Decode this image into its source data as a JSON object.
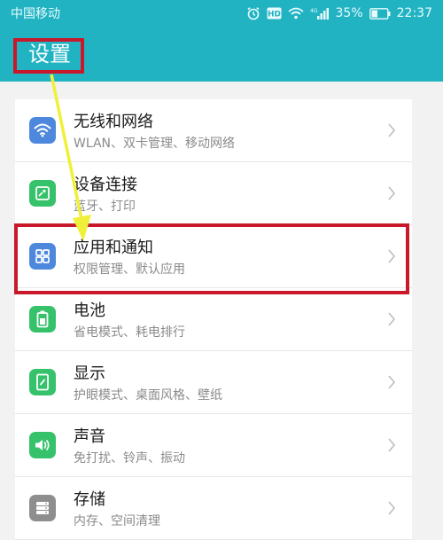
{
  "status_bar": {
    "carrier": "中国移动",
    "icons": [
      "alarm-icon",
      "hd-icon",
      "wifi-icon",
      "signal-4g-icon",
      "battery-icon"
    ],
    "signal_label": "4G",
    "battery_percent": "35%",
    "time": "22:37"
  },
  "app_bar": {
    "title": "设置"
  },
  "colors": {
    "header": "#22b3c3",
    "highlight": "#c8182a",
    "arrow": "#f0f03a",
    "icon_blue": "#4e88dc",
    "icon_green": "#35c26b",
    "icon_gray": "#8e8e8e"
  },
  "settings": {
    "items": [
      {
        "title": "无线和网络",
        "subtitle": "WLAN、双卡管理、移动网络",
        "icon": "wifi-icon"
      },
      {
        "title": "设备连接",
        "subtitle": "蓝牙、打印",
        "icon": "device-connect-icon"
      },
      {
        "title": "应用和通知",
        "subtitle": "权限管理、默认应用",
        "icon": "apps-grid-icon"
      },
      {
        "title": "电池",
        "subtitle": "省电模式、耗电排行",
        "icon": "battery-icon"
      },
      {
        "title": "显示",
        "subtitle": "护眼模式、桌面风格、壁纸",
        "icon": "display-icon"
      },
      {
        "title": "声音",
        "subtitle": "免打扰、铃声、振动",
        "icon": "speaker-icon"
      },
      {
        "title": "存储",
        "subtitle": "内存、空间清理",
        "icon": "storage-icon"
      }
    ]
  }
}
